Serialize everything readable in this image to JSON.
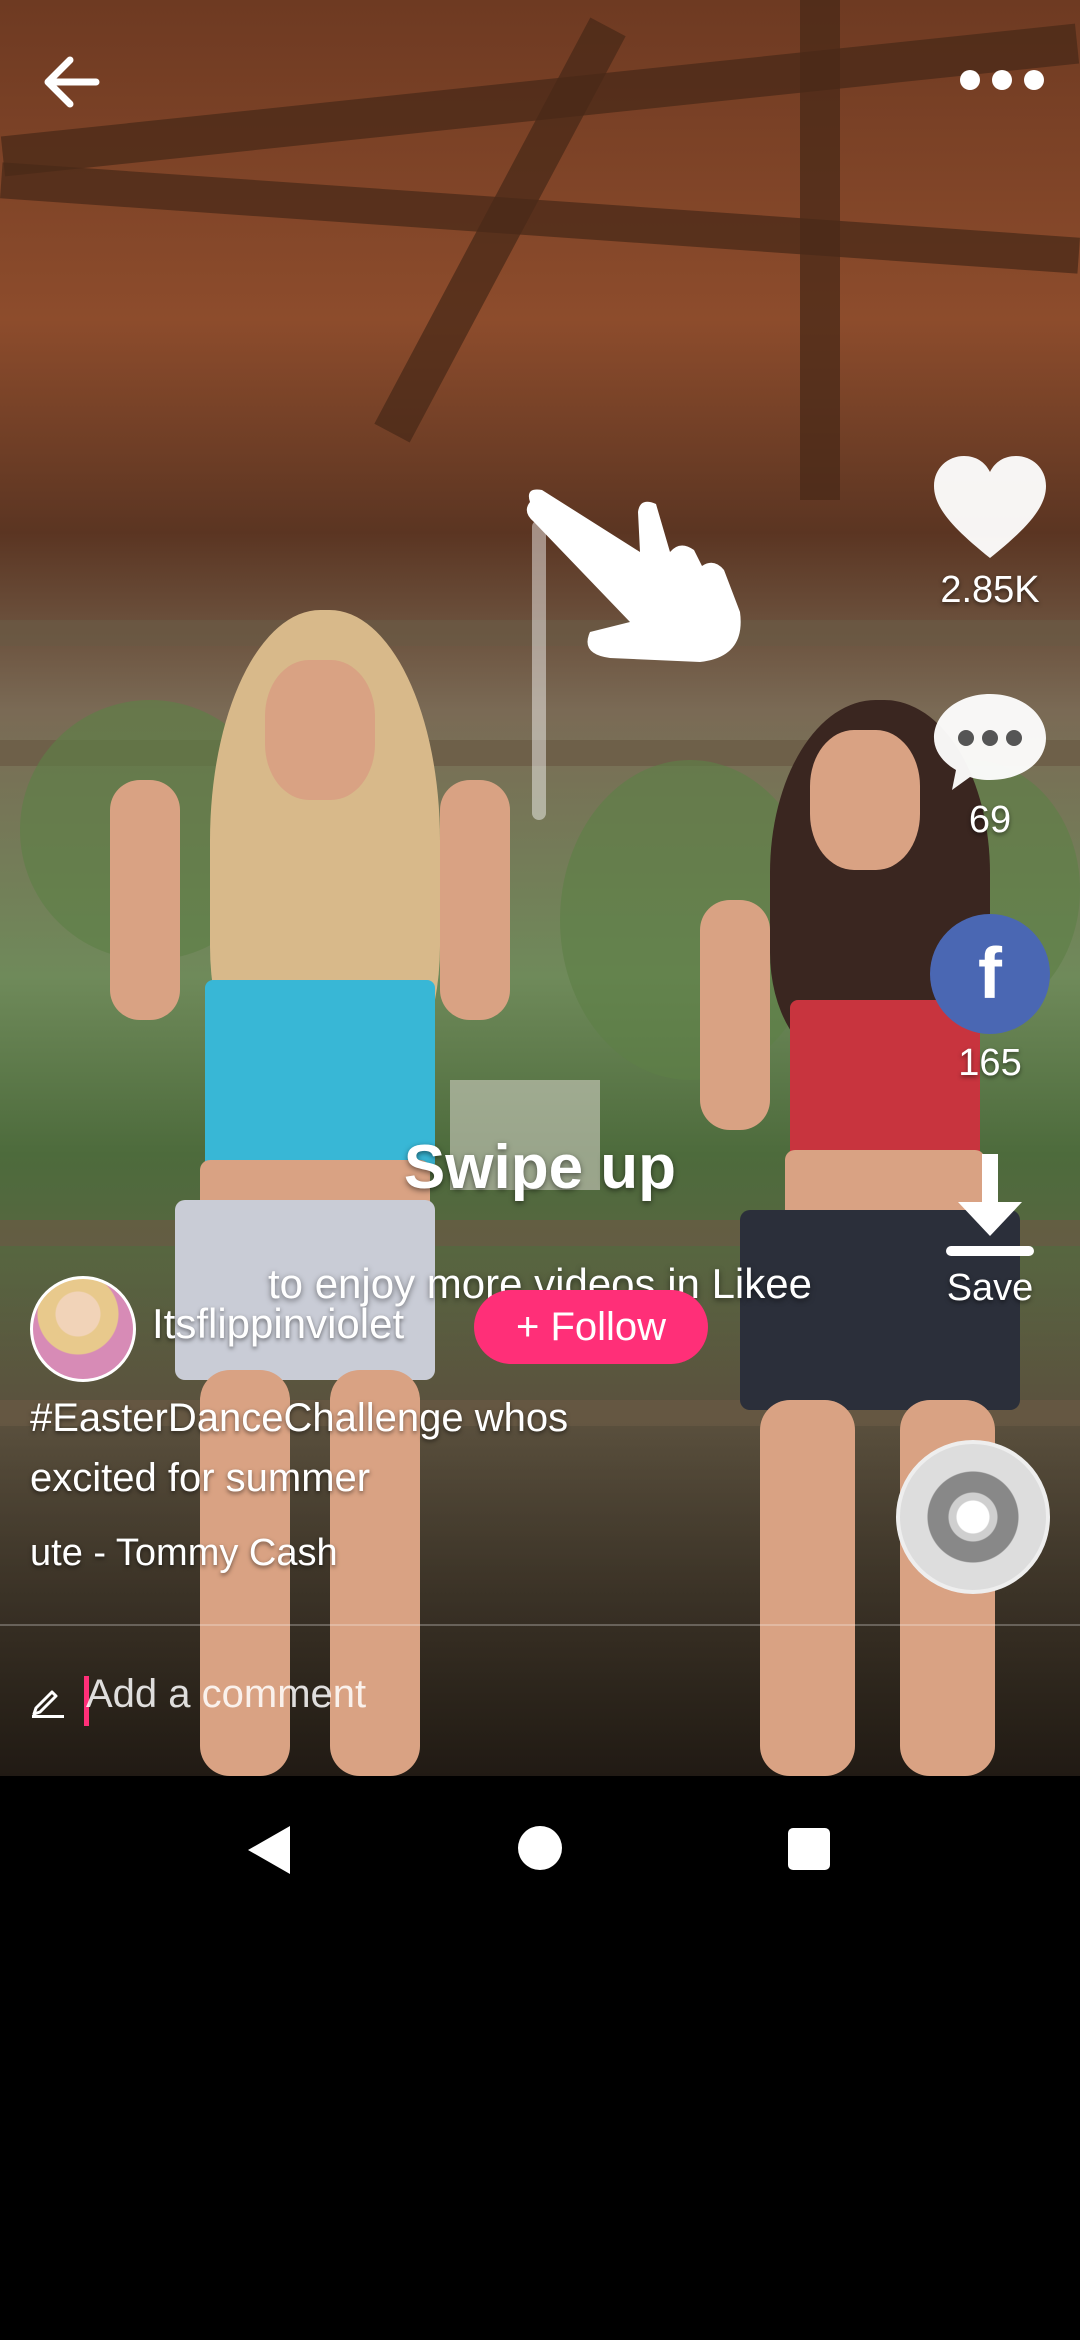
{
  "top_bar": {
    "back_icon": "arrow-left-icon",
    "more_icon": "more-horizontal-icon"
  },
  "swipe_hint": {
    "title": "Swipe up",
    "subtitle": "to enjoy more videos in Likee",
    "icon": "swipe-hand-icon"
  },
  "actions": {
    "likes": "2.85K",
    "comments": "69",
    "shares": "165",
    "save_label": "Save",
    "share_icon_letter": "f"
  },
  "author": {
    "username": "Itsflippinviolet",
    "follow_label": "+ Follow"
  },
  "caption": "#EasterDanceChallenge whos excited for summer",
  "music": "ute - Tommy Cash",
  "comment": {
    "placeholder": "Add a comment"
  },
  "colors": {
    "accent": "#ff2f78",
    "facebook": "#4a67b3"
  }
}
